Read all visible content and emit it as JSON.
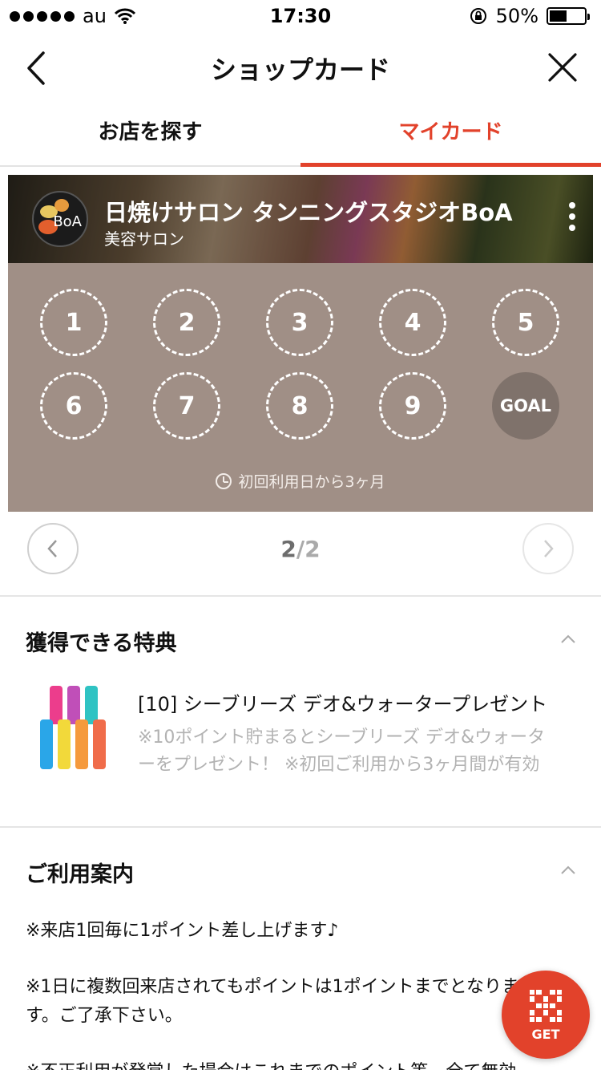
{
  "status_bar": {
    "carrier": "au",
    "time": "17:30",
    "battery_percent": "50%",
    "battery_level": 0.5
  },
  "header": {
    "title": "ショップカード"
  },
  "tabs": [
    {
      "label": "お店を探す",
      "active": false
    },
    {
      "label": "マイカード",
      "active": true
    }
  ],
  "card": {
    "shop_name": "日焼けサロン タンニングスタジオBoA",
    "category": "美容サロン",
    "logo_text": "BoA",
    "stamps": [
      "1",
      "2",
      "3",
      "4",
      "5",
      "6",
      "7",
      "8",
      "9"
    ],
    "goal_label": "GOAL",
    "validity": "初回利用日から3ヶ月"
  },
  "pager": {
    "current": "2",
    "total": "/2"
  },
  "benefits": {
    "title": "獲得できる特典",
    "item": {
      "title": "[10] シーブリーズ デオ&ウォータープレゼント",
      "desc_line1": "※10ポイント貯まるとシーブリーズ デオ&ウォータ",
      "desc_line2": "ーをプレゼント！ ※初回ご利用から3ヶ月間が有効"
    }
  },
  "guide": {
    "title": "ご利用案内",
    "line1": "※来店1回毎に1ポイント差し上げます♪",
    "line2": "※1日に複数回来店されてもポイントは1ポイントまでとなりま",
    "line3": "す。ご了承下さい。",
    "line4": "※不正利用が発覚した場合はこれまでのポイント等、全て無効"
  },
  "fab": {
    "label": "GET"
  },
  "colors": {
    "accent": "#e2422b",
    "card_bg": "#a08f86",
    "goal_bg": "#7f726b"
  }
}
